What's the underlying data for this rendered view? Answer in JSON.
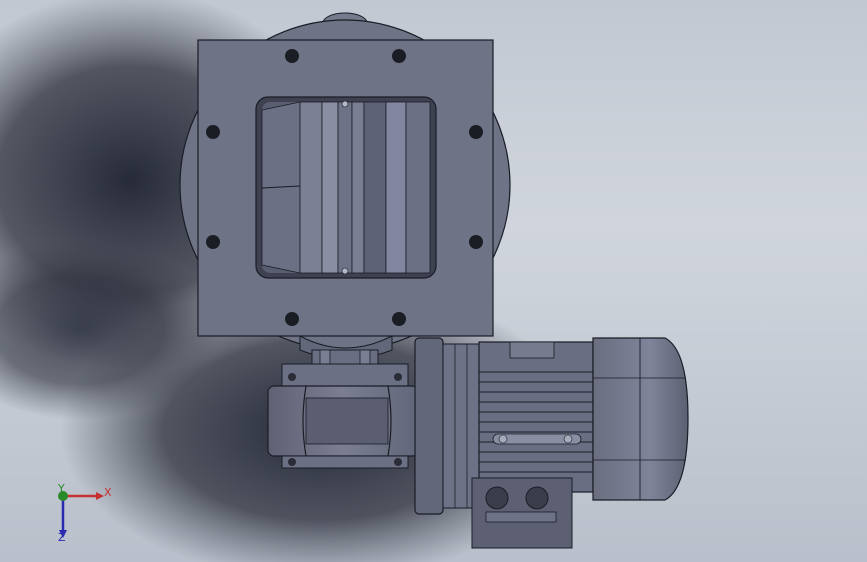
{
  "viewport": {
    "background_top": "#c2c8d2",
    "background_bottom": "#b9c0cb",
    "model_color": "#6f7386",
    "edge_color": "#1a1c26"
  },
  "triad": {
    "x_label": "X",
    "y_label": "Y",
    "z_label": "Z",
    "x_color": "#c83030",
    "y_color": "#2a8a2a",
    "z_color": "#2a2ab0"
  }
}
